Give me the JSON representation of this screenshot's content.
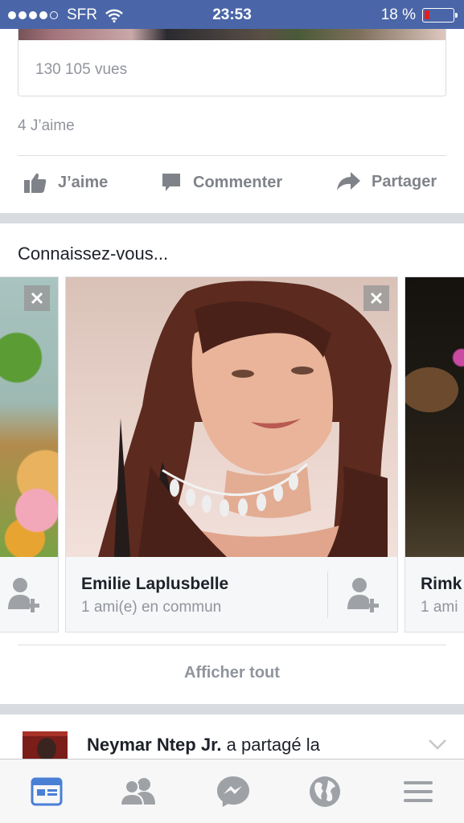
{
  "status_bar": {
    "carrier": "SFR",
    "time": "23:53",
    "battery_text": "18 %",
    "battery_level": 0.18,
    "signal_bars": 4,
    "signal_total": 5
  },
  "previous_post": {
    "views": "130 105 vues",
    "likes": "4 J’aime",
    "actions": {
      "like": "J’aime",
      "comment": "Commenter",
      "share": "Partager"
    }
  },
  "pymk": {
    "title": "Connaissez-vous...",
    "cards": [
      {
        "name": "",
        "mutual": ""
      },
      {
        "name": "Emilie Laplusbelle",
        "mutual": "1 ami(e) en commun"
      },
      {
        "name": "Rimk",
        "mutual": "1 ami"
      }
    ],
    "see_all": "Afficher tout"
  },
  "next_story": {
    "author": "Neymar Ntep Jr.",
    "action": " a partagé la"
  },
  "tab_bar": {
    "tabs": [
      {
        "icon": "news-feed-icon",
        "active": true
      },
      {
        "icon": "friends-icon",
        "active": false
      },
      {
        "icon": "messenger-icon",
        "active": false
      },
      {
        "icon": "globe-icon",
        "active": false
      },
      {
        "icon": "menu-icon",
        "active": false
      }
    ]
  },
  "colors": {
    "brand": "#4a66a8",
    "active_tab": "#4a7fd6",
    "inactive": "#9ea1a6",
    "battery_low": "#e02020"
  }
}
